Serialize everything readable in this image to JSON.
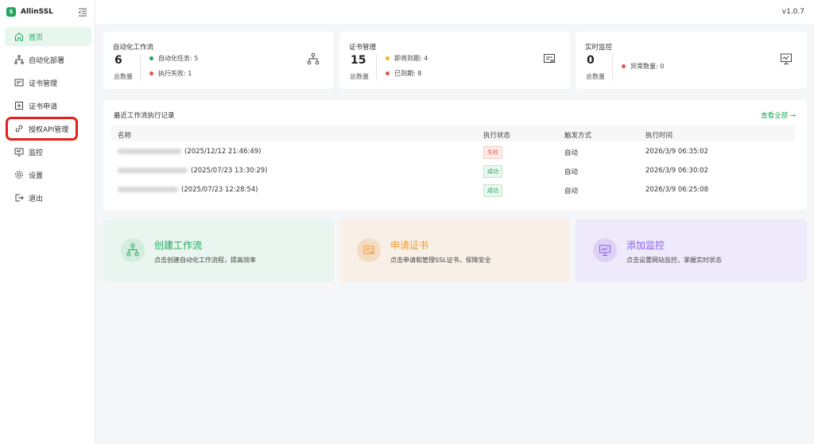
{
  "app": {
    "name": "AllinSSL",
    "logo_text": "S",
    "version": "v1.0.7"
  },
  "sidebar": {
    "items": [
      {
        "label": "首页",
        "icon": "home-icon",
        "active": true
      },
      {
        "label": "自动化部署",
        "icon": "workflow-icon"
      },
      {
        "label": "证书管理",
        "icon": "certificate-icon"
      },
      {
        "label": "证书申请",
        "icon": "plus-box-icon"
      },
      {
        "label": "授权API管理",
        "icon": "link-icon"
      },
      {
        "label": "监控",
        "icon": "monitor-icon"
      },
      {
        "label": "设置",
        "icon": "gear-icon"
      },
      {
        "label": "退出",
        "icon": "logout-icon"
      }
    ]
  },
  "stats": {
    "workflow": {
      "title": "自动化工作流",
      "count": "6",
      "sub": "总数量",
      "line1": "自动化任务: 5",
      "line2": "执行失败: 1",
      "icon": "workflow-icon"
    },
    "cert": {
      "title": "证书管理",
      "count": "15",
      "sub": "总数量",
      "line1": "即将到期: 4",
      "line2": "已到期: 8",
      "icon": "certificate-icon"
    },
    "monitor": {
      "title": "实时监控",
      "count": "0",
      "sub": "总数量",
      "line1": "异常数量: 0",
      "icon": "monitor-icon"
    }
  },
  "records": {
    "title": "最近工作流执行记录",
    "view_all": "查看全部 →",
    "columns": [
      "名称",
      "执行状态",
      "触发方式",
      "执行时间"
    ],
    "rows": [
      {
        "name_suffix": "(2025/12/12 21:46:49)",
        "status": "失败",
        "status_type": "fail",
        "trigger": "自动",
        "time": "2026/3/9 06:35:02"
      },
      {
        "name_suffix": "(2025/07/23 13:30:29)",
        "status": "成功",
        "status_type": "ok",
        "trigger": "自动",
        "time": "2026/3/9 06:30:02"
      },
      {
        "name_suffix": "(2025/07/23 12:28:54)",
        "status": "成功",
        "status_type": "ok",
        "trigger": "自动",
        "time": "2026/3/9 06:25:08"
      }
    ]
  },
  "quick": [
    {
      "title": "创建工作流",
      "desc": "点击创建自动化工作流程，提高效率",
      "bg": "#e9f5ef",
      "circle": "#d2ecdd",
      "color": "#22a45d",
      "icon": "workflow-icon"
    },
    {
      "title": "申请证书",
      "desc": "点击申请和管理SSL证书，保障安全",
      "bg": "#f8efe6",
      "circle": "#f4dcc4",
      "color": "#ef9a33",
      "icon": "certificate-icon"
    },
    {
      "title": "添加监控",
      "desc": "点击设置网站监控，掌握实时状态",
      "bg": "#efeafb",
      "circle": "#ddd2f6",
      "color": "#8a5cf0",
      "icon": "monitor-icon"
    }
  ],
  "colors": {
    "accent": "#22a45d",
    "fail": "#e5564b",
    "warn": "#f0b429",
    "highlight": "#e5201c"
  }
}
